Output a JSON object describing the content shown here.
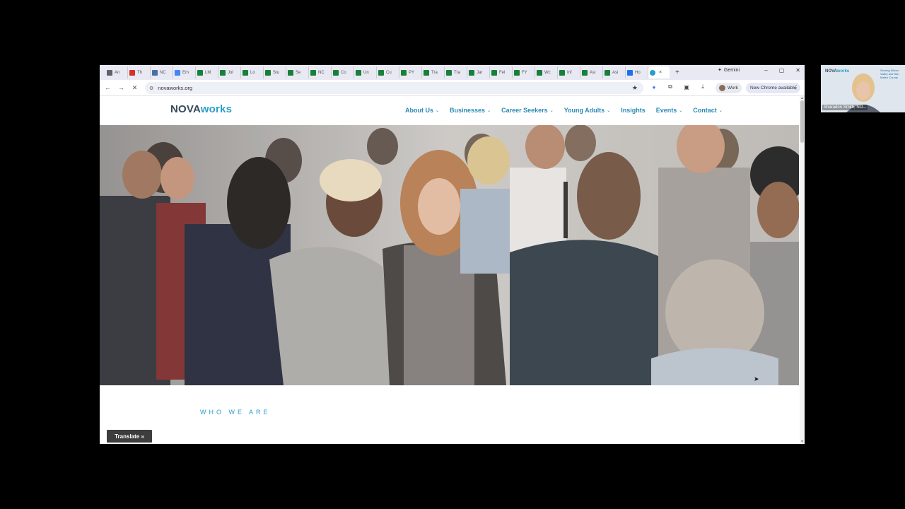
{
  "browser": {
    "tabs": [
      {
        "label": "An",
        "icon": "chrome-icon",
        "color": "#5f6368"
      },
      {
        "label": "Th",
        "icon": "gmail-icon",
        "color": "#d93025"
      },
      {
        "label": "NC",
        "icon": "doc-icon",
        "color": "#4a6fa5"
      },
      {
        "label": "Em",
        "icon": "google-icon",
        "color": "#4285f4"
      },
      {
        "label": "LM",
        "icon": "sheets-icon",
        "color": "#188038"
      },
      {
        "label": "Jol",
        "icon": "sheets-icon",
        "color": "#188038"
      },
      {
        "label": "Lo",
        "icon": "sheets-icon",
        "color": "#188038"
      },
      {
        "label": "Stu",
        "icon": "sheets-icon",
        "color": "#188038"
      },
      {
        "label": "Se",
        "icon": "sheets-icon",
        "color": "#188038"
      },
      {
        "label": "NC",
        "icon": "sheets-icon",
        "color": "#188038"
      },
      {
        "label": "Co",
        "icon": "sheets-icon",
        "color": "#188038"
      },
      {
        "label": "Un",
        "icon": "sheets-icon",
        "color": "#188038"
      },
      {
        "label": "Cu",
        "icon": "sheets-icon",
        "color": "#188038"
      },
      {
        "label": "PY",
        "icon": "sheets-icon",
        "color": "#188038"
      },
      {
        "label": "Tra",
        "icon": "sheets-icon",
        "color": "#188038"
      },
      {
        "label": "Tra",
        "icon": "sheets-icon",
        "color": "#188038"
      },
      {
        "label": "Jar",
        "icon": "sheets-icon",
        "color": "#188038"
      },
      {
        "label": "Fel",
        "icon": "sheets-icon",
        "color": "#188038"
      },
      {
        "label": "FY",
        "icon": "sheets-icon",
        "color": "#188038"
      },
      {
        "label": "Wc",
        "icon": "sheets-icon",
        "color": "#188038"
      },
      {
        "label": "Inf",
        "icon": "sheets-icon",
        "color": "#188038"
      },
      {
        "label": "Asi",
        "icon": "sheets-icon",
        "color": "#188038"
      },
      {
        "label": "Asi",
        "icon": "sheets-icon",
        "color": "#188038"
      },
      {
        "label": "Ho",
        "icon": "chrome-icon",
        "color": "#1a73e8"
      }
    ],
    "active_tab": {
      "icon": "novaworks-icon",
      "close": "×"
    },
    "new_tab": "+",
    "gemini_label": "Gemini",
    "window_controls": [
      "–",
      "▢",
      "✕"
    ],
    "url": "novaworks.org",
    "profile_label": "Work",
    "update_label": "New Chrome available"
  },
  "site": {
    "logo_nova": "NOVA",
    "logo_works": "works",
    "nav": [
      {
        "label": "About Us",
        "dropdown": true
      },
      {
        "label": "Businesses",
        "dropdown": true
      },
      {
        "label": "Career Seekers",
        "dropdown": true
      },
      {
        "label": "Young Adults",
        "dropdown": true
      },
      {
        "label": "Insights",
        "dropdown": false
      },
      {
        "label": "Events",
        "dropdown": true
      },
      {
        "label": "Contact",
        "dropdown": true
      }
    ],
    "section_eyebrow": "WHO WE ARE",
    "translate_label": "Translate »",
    "accent": "#2a9dc9"
  },
  "video_tile": {
    "name": "Sharadon Smith, NO...",
    "logo_nova": "NOVA",
    "logo_works": "works",
    "tagline": "Serving Silicon Valley and San Mateo County"
  }
}
